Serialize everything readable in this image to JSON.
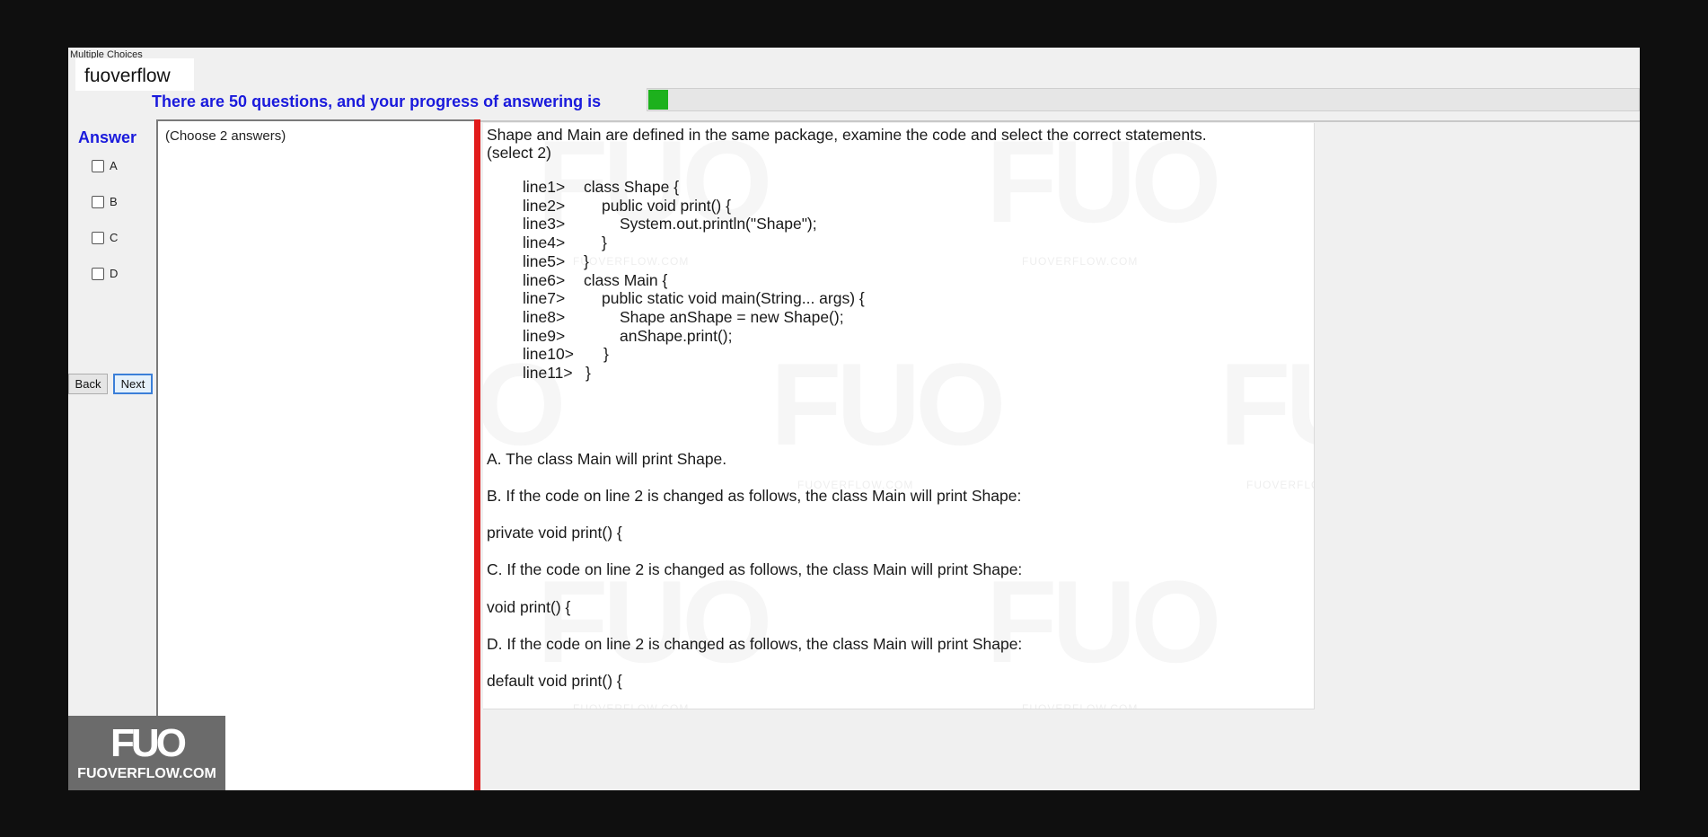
{
  "window": {
    "title": "Multiple Choices"
  },
  "tag": "fuoverflow",
  "progress": {
    "label": "There are 50 questions, and your progress of answering is",
    "value": 0.02,
    "color": "#1db11d"
  },
  "answer_panel": {
    "title": "Answer",
    "options": [
      "A",
      "B",
      "C",
      "D"
    ],
    "back_label": "Back",
    "next_label": "Next"
  },
  "choose_hint": "(Choose 2 answers)",
  "question": {
    "prompt_line1": "Shape and Main are defined in the same package, examine the code and select the correct statements.",
    "prompt_line2": "(select 2)",
    "code": [
      {
        "num": "line1>",
        "code": "class Shape {"
      },
      {
        "num": "line2>",
        "code": "public void print() {"
      },
      {
        "num": "line3>",
        "code": "System.out.println(\"Shape\");"
      },
      {
        "num": "line4>",
        "code": "}"
      },
      {
        "num": "line5>",
        "code": "}"
      },
      {
        "num": "line6>",
        "code": "class Main {"
      },
      {
        "num": "line7>",
        "code": "public static void main(String... args) {"
      },
      {
        "num": "line8>",
        "code": "Shape anShape = new Shape();"
      },
      {
        "num": "line9>",
        "code": "anShape.print();"
      },
      {
        "num": "line10>",
        "code": "}"
      },
      {
        "num": "line11>",
        "code": "}"
      }
    ],
    "choices": [
      "A.  The class Main will print Shape.",
      "B.  If the code on line 2 is changed as follows, the class Main will print Shape:",
      "private void print() {",
      "C.  If the code on line 2 is changed as follows, the class Main will print Shape:",
      "void print() {",
      "D.  If the code on line 2 is changed as follows, the class Main will print Shape:",
      "default void print() {"
    ]
  },
  "watermark": {
    "mark": "FUO",
    "site": "FUOVERFLOW.COM"
  },
  "logo": {
    "mark": "FUO",
    "site": "FUOVERFLOW.COM"
  }
}
